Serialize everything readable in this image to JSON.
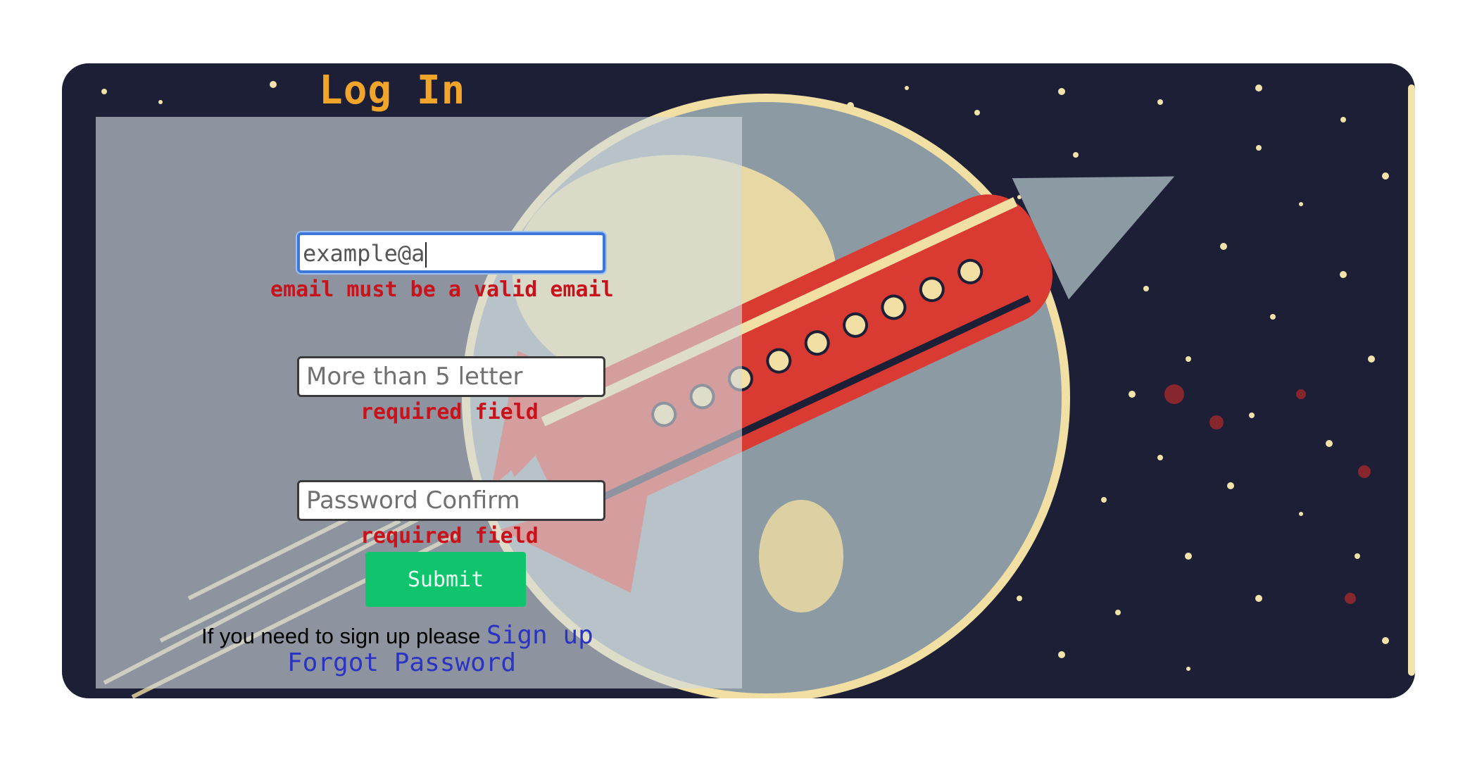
{
  "form": {
    "title": "Log In",
    "email": {
      "value": "example@a",
      "error": "email must be a valid email"
    },
    "password": {
      "placeholder": "More than 5 letter",
      "error": "required field"
    },
    "password_confirm": {
      "placeholder": "Password Confirm",
      "error": "required field"
    },
    "submit_label": "Submit",
    "signup_prompt": "If you need to sign up please",
    "signup_link": "Sign up",
    "forgot_link": "Forgot Password"
  },
  "colors": {
    "title": "#f1a52a",
    "error": "#c8131c",
    "submit": "#0fc46d",
    "link": "#2b34c2",
    "focus": "#3d78d8"
  },
  "background": {
    "icon": "rocket-and-planet-illustration"
  }
}
